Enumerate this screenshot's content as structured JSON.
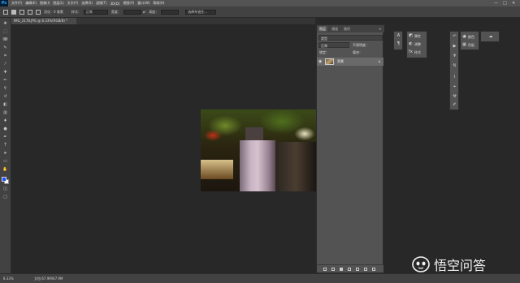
{
  "app": {
    "logo": "Ps"
  },
  "menubar": {
    "items": [
      "文件(F)",
      "编辑(E)",
      "图像(I)",
      "图层(L)",
      "文字(Y)",
      "选择(S)",
      "滤镜(T)",
      "3D(D)",
      "视图(V)",
      "窗口(W)",
      "帮助(H)"
    ],
    "window_controls": [
      "—",
      "□",
      "✕"
    ]
  },
  "options_bar": {
    "feather_label": "羽化：0 像素",
    "style_label": "样式：",
    "style_value": "正常",
    "width_label": "宽度：",
    "height_label": "高度：",
    "refine_button": "选择并遮住..."
  },
  "document_tab": {
    "title": "IMG_2178.JPG @ 8.33%(RGB/8) *"
  },
  "layers_panel": {
    "tabs": [
      "图层",
      "通道",
      "路径"
    ],
    "filter_label": "类型",
    "blend_mode": "正常",
    "opacity_label": "不透明度：",
    "lock_label": "锁定：",
    "fill_label": "填充：",
    "layer_name": "背景"
  },
  "properties_panel": {
    "items": [
      "属性",
      "调整",
      "样式"
    ]
  },
  "color_panel": {
    "items": [
      "颜色",
      "色板"
    ]
  },
  "status_bar": {
    "zoom": "8.33%",
    "doc_info": "文档:67.9M/67.9M"
  },
  "watermark": {
    "text": "悟空问答"
  }
}
